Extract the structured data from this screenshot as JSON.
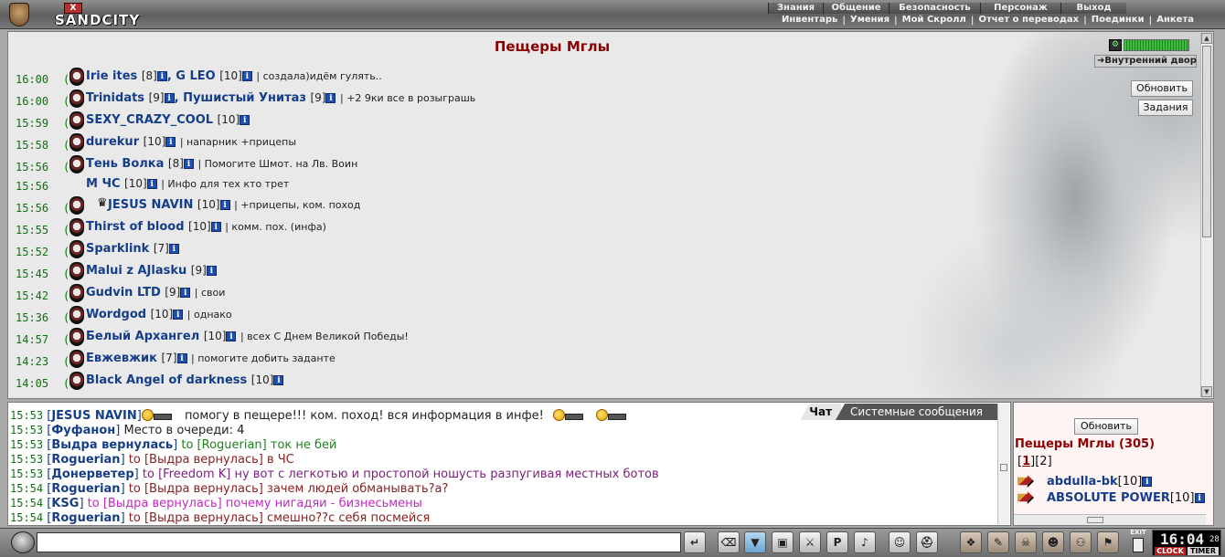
{
  "app": {
    "name": "SANDCITY",
    "logo_mark": "X"
  },
  "menu_top": [
    "Знания",
    "Общение",
    "Безопасность",
    "Персонаж",
    "Выход"
  ],
  "menu_sub": [
    "Инвентарь",
    "Умения",
    "Мой Скролл",
    "Отчет о переводах",
    "Поединки",
    "Анкета"
  ],
  "room": {
    "title": "Пещеры Мглы",
    "location": "Внутренний двор",
    "refresh_label": "Обновить",
    "tasks_label": "Задания",
    "gauge_level": 1.0,
    "rows": [
      {
        "time": "16:00",
        "names": [
          {
            "name": "Irie ites",
            "lvl": "[8]"
          },
          {
            "name": "G LEO",
            "lvl": "[10]"
          }
        ],
        "status": "| создала)идём гулять.."
      },
      {
        "time": "16:00",
        "names": [
          {
            "name": "Trinidats",
            "lvl": "[9]"
          },
          {
            "name": "Пушистый Унитаз",
            "lvl": "[9]"
          }
        ],
        "status": "| +2 9ки все в розыграшь"
      },
      {
        "time": "15:59",
        "names": [
          {
            "name": "SEXY_CRAZY_COOL",
            "lvl": "[10]"
          }
        ],
        "status": ""
      },
      {
        "time": "15:58",
        "names": [
          {
            "name": "durekur",
            "lvl": "[10]"
          }
        ],
        "status": "| напарник +прицепы"
      },
      {
        "time": "15:56",
        "names": [
          {
            "name": "Тень Волка",
            "lvl": "[8]"
          }
        ],
        "status": "| Помогите Шмот. на Лв. Воин"
      },
      {
        "time": "15:56",
        "names": [
          {
            "name": "М ЧС",
            "lvl": "[10]"
          }
        ],
        "status": "| Инфо для тех кто трет",
        "no_icon": true
      },
      {
        "time": "15:56",
        "names": [
          {
            "name": "JESUS NAVIN",
            "lvl": "[10]"
          }
        ],
        "status": "| +прицепы, ком. поход",
        "crown": true
      },
      {
        "time": "15:55",
        "names": [
          {
            "name": "Thirst of blood",
            "lvl": "[10]"
          }
        ],
        "status": "| комм. пох. (инфа)"
      },
      {
        "time": "15:52",
        "names": [
          {
            "name": "Sparklink",
            "lvl": "[7]"
          }
        ],
        "status": ""
      },
      {
        "time": "15:45",
        "names": [
          {
            "name": "Malui z AJlasku",
            "lvl": "[9]"
          }
        ],
        "status": ""
      },
      {
        "time": "15:42",
        "names": [
          {
            "name": "Gudvin LTD",
            "lvl": "[9]"
          }
        ],
        "status": "| свои"
      },
      {
        "time": "15:36",
        "names": [
          {
            "name": "Wordgod",
            "lvl": "[10]"
          }
        ],
        "status": "| однако"
      },
      {
        "time": "14:57",
        "names": [
          {
            "name": "Белый Архангел",
            "lvl": "[10]"
          }
        ],
        "status": "| всех С Днем Великой Победы!"
      },
      {
        "time": "14:23",
        "names": [
          {
            "name": "Евжевжик",
            "lvl": "[7]"
          }
        ],
        "status": "| помогите добить заданте"
      },
      {
        "time": "14:05",
        "names": [
          {
            "name": "Black Angel of darkness",
            "lvl": "[10]"
          }
        ],
        "status": ""
      }
    ]
  },
  "chat": {
    "tab_chat": "Чат",
    "tab_system": "Системные сообщения",
    "lines": [
      {
        "time": "15:53",
        "author": "JESUS NAVIN",
        "to": "",
        "msg": "помогу в пещере!!! ком. поход! вся информация в инфе!",
        "color": "msg",
        "smiles": true
      },
      {
        "time": "15:53",
        "author": "Фуфанон",
        "to": "",
        "msg": "Место в очереди: 4",
        "color": "msg"
      },
      {
        "time": "15:53",
        "author": "Выдра вернулась",
        "to": "to [Roguerian]",
        "msg": "ток не бей",
        "color": "green"
      },
      {
        "time": "15:53",
        "author": "Roguerian",
        "to": "to [Выдра вернулась]",
        "msg": "в ЧС",
        "color": "to"
      },
      {
        "time": "15:53",
        "author": "Донерветер",
        "to": "to [Freedom K]",
        "msg": "ну вот с легкотью и простопой ношусть разпугивая местных ботов",
        "color": "purple"
      },
      {
        "time": "15:54",
        "author": "Roguerian",
        "to": "to [Выдра вернулась]",
        "msg": "зачем людей обманывать?а?",
        "color": "to"
      },
      {
        "time": "15:54",
        "author": "KSG",
        "to": "to [Выдра вернулась]",
        "msg": "почему нигадяи - бизнесьмены",
        "color": "magenta"
      },
      {
        "time": "15:54",
        "author": "Roguerian",
        "to": "to [Выдра вернулась]",
        "msg": "смешно??с себя посмейся",
        "color": "to"
      }
    ]
  },
  "online": {
    "refresh_label": "Обновить",
    "title": "Пещеры Мглы (305)",
    "page_current": "1",
    "page_other": "2",
    "users": [
      {
        "name": "abdulla-bk",
        "lvl": "[10]"
      },
      {
        "name": "ABSOLUTE POWER",
        "lvl": "[10]"
      }
    ]
  },
  "bottom": {
    "input_value": "",
    "tools": [
      "send-icon",
      "eraser-icon",
      "filter-icon",
      "save-icon",
      "fight-icon",
      "private-icon",
      "sound-icon",
      "smile-icon",
      "helmet-icon",
      "bag-icon",
      "scroll-icon",
      "skull-icon",
      "mask-icon",
      "group-icon",
      "flag-icon",
      "exit-icon"
    ],
    "exit_label": "EXIT",
    "clock_time": "16:04",
    "clock_sec": "28",
    "clock_label": "CLOCK",
    "timer_label": "TIMER"
  }
}
